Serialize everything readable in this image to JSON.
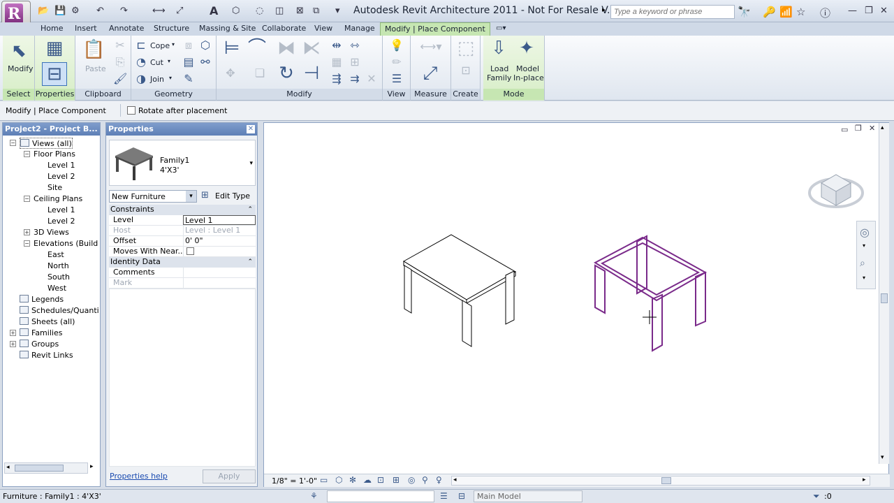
{
  "title_bar": {
    "app_title": "Autodesk Revit Architecture 2011 - Not For Resale V...",
    "search_placeholder": "Type a keyword or phrase"
  },
  "tabs": [
    {
      "label": "Home"
    },
    {
      "label": "Insert"
    },
    {
      "label": "Annotate"
    },
    {
      "label": "Structure"
    },
    {
      "label": "Massing & Site"
    },
    {
      "label": "Collaborate"
    },
    {
      "label": "View"
    },
    {
      "label": "Manage"
    },
    {
      "label": "Modify | Place Component",
      "active": true
    }
  ],
  "ribbon": {
    "panels": {
      "select": "Select",
      "properties": "Properties",
      "clipboard": "Clipboard",
      "geometry": "Geometry",
      "modify": "Modify",
      "view": "View",
      "measure": "Measure",
      "create": "Create",
      "mode": "Mode"
    },
    "modify_label": "Modify",
    "paste_label": "Paste",
    "cope_label": "Cope",
    "cut_label": "Cut",
    "join_label": "Join",
    "load_family_line1": "Load",
    "load_family_line2": "Family",
    "model_inplace_line1": "Model",
    "model_inplace_line2": "In-place"
  },
  "options_bar": {
    "context_label": "Modify | Place Component",
    "rotate_label": "Rotate after placement",
    "rotate_checked": false
  },
  "project_browser": {
    "title": "Project2 - Project B...",
    "items": [
      {
        "label": "Views (all)"
      },
      {
        "label": "Floor Plans"
      },
      {
        "label": "Level 1"
      },
      {
        "label": "Level 2"
      },
      {
        "label": "Site"
      },
      {
        "label": "Ceiling Plans"
      },
      {
        "label": "Level 1"
      },
      {
        "label": "Level 2"
      },
      {
        "label": "3D Views"
      },
      {
        "label": "Elevations (Build"
      },
      {
        "label": "East"
      },
      {
        "label": "North"
      },
      {
        "label": "South"
      },
      {
        "label": "West"
      },
      {
        "label": "Legends"
      },
      {
        "label": "Schedules/Quanti"
      },
      {
        "label": "Sheets (all)"
      },
      {
        "label": "Families"
      },
      {
        "label": "Groups"
      },
      {
        "label": "Revit Links"
      }
    ]
  },
  "properties": {
    "title": "Properties",
    "family_name": "Family1",
    "family_type": "4'X3'",
    "category_select": "New Furniture",
    "edit_type_label": "Edit Type",
    "groups": {
      "constraints": "Constraints",
      "identity": "Identity Data"
    },
    "rows": {
      "level_k": "Level",
      "level_v": "Level 1",
      "host_k": "Host",
      "host_v": "Level : Level 1",
      "offset_k": "Offset",
      "offset_v": "0'  0\"",
      "moves_k": "Moves With Near...",
      "comments_k": "Comments",
      "mark_k": "Mark"
    },
    "help_link": "Properties help",
    "apply_label": "Apply"
  },
  "view_control_bar": {
    "scale": "1/8\" = 1'-0\""
  },
  "status_bar": {
    "text": "Furniture : Family1 : 4'X3'",
    "workset": "Main Model",
    "filter_count": ":0"
  },
  "colors": {
    "accent_green": "#c6e6b2",
    "preview_purple": "#7a2a8a",
    "panel_header_blue": "#6d8fc4"
  }
}
